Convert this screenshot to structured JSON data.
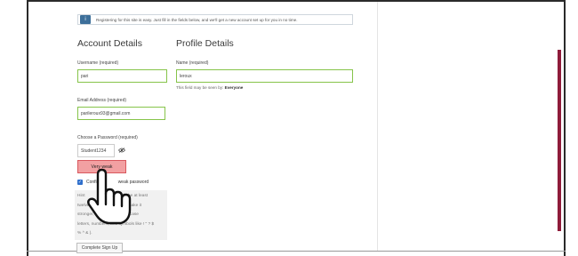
{
  "notice": {
    "icon": "info-icon",
    "text": "Registering for this site is easy. Just fill in the fields below, and we'll get a new account set up for you in no time."
  },
  "account": {
    "title": "Account Details",
    "username_label": "Username (required)",
    "username_value": "pari",
    "email_label": "Email Address (required)",
    "email_value": "parileroux93@gmail.com",
    "password_label": "Choose a Password (required)",
    "password_value": "Student1234",
    "strength_label": "Very weak",
    "confirm_prefix": "Confi",
    "confirm_suffix": "weak password",
    "password_hint_lines": [
      [
        "Hint",
        "ould be at least"
      ],
      [
        "twelve",
        ". To make it"
      ],
      [
        "stronger,",
        "and lower case"
      ],
      [
        "letters, numbers, and symbols like ! \" ? $"
      ],
      [
        "% ^ & )."
      ]
    ],
    "submit_label": "Complete Sign Up"
  },
  "profile": {
    "title": "Profile Details",
    "name_label": "Name (required)",
    "name_value": "leroux",
    "visibility_prefix": "This field may be seen by:",
    "visibility_value": "Everyone"
  },
  "icons": {
    "eye": "eye-slash-icon",
    "cursor": "hand-pointer-icon"
  },
  "colors": {
    "valid_border": "#86c44a",
    "weak_strength": "#f2a0a2",
    "accent_bar": "#8e1b3a",
    "notice_icon": "#3d6f9a"
  }
}
